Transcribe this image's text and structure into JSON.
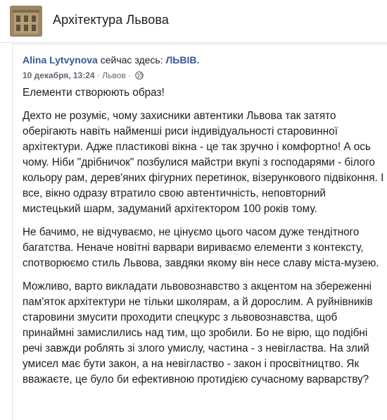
{
  "group": {
    "title": "Архітектура Львова"
  },
  "post": {
    "author": "Alina Lytvynova",
    "checkin_text": "сейчас здесь:",
    "location": "ЛЬВІВ.",
    "date": "10 декабря, 13:24",
    "meta_separator": " · ",
    "place": "Львов",
    "paragraphs": [
      "Елементи створюють образ!",
      "Дехто не розуміє, чому захисники автентики Львова так затято оберігають навіть найменші риси індивідуальності старовинної архітектури. Адже пластикові вікна - це так зручно і комфортно! А ось чому. Ніби \"дрібничок\" позбулися майстри вкупі з господарями - білого кольору рам, дерев'яних фігурних перетинок, візерункового підвіконня. І все, вікно одразу втратило свою автентичність, неповторний мистецький шарм, задуманий архітектором 100 років тому.",
      "Не бачимо, не відчуваємо, не цінуємо цього часом дуже тендітного багатства. Неначе новітні варвари вириваємо елементи з контексту, спотворюємо стиль Львова, завдяки якому він несе славу міста-музею.",
      "Можливо, варто викладати львовознавство з акцентом на збереженні пам'яток архітектури не тільки школярам, а й дорослим. А руйнівників старовини змусити проходити спецкурс з львовознавства, щоб принаймні замислились над тим, що зробили. Бо не вірю, що подібні речі завжди роблять зі злого умислу, частина - з невігластва. На злий умисел має бути закон, а на невігластво - закон і просвітництво. Як вважаєте, це було би ефективною протидією сучасному варварству?"
    ]
  },
  "colors": {
    "link": "#385898",
    "text": "#1c1e21",
    "meta": "#616770",
    "border": "#dddfe2"
  },
  "icons": {
    "privacy": "globe-icon"
  }
}
